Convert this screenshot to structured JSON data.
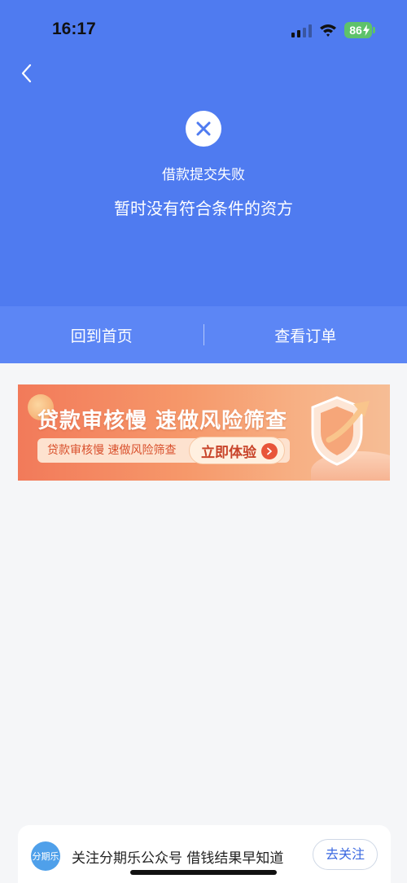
{
  "status_bar": {
    "time": "16:17",
    "battery": "86"
  },
  "result": {
    "title": "借款提交失败",
    "subtitle": "暂时没有符合条件的资方"
  },
  "actions": {
    "home_label": "回到首页",
    "orders_label": "查看订单"
  },
  "banner": {
    "title": "贷款审核慢  速做风险筛查",
    "subtitle": "贷款审核慢  速做风险筛查",
    "button_label": "立即体验"
  },
  "follow": {
    "logo_text": "分期乐",
    "text": "关注分期乐公众号  借钱结果早知道",
    "button_label": "去关注"
  },
  "colors": {
    "header_bg": "#4f7bf0",
    "actions_bg": "#5c86f5",
    "page_bg": "#f5f6f8",
    "accent": "#3a68e0"
  }
}
